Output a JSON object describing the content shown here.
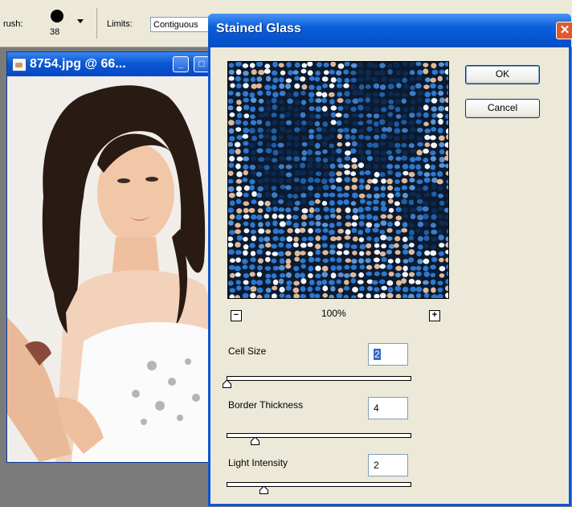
{
  "options_bar": {
    "brush_label": "rush:",
    "brush_size": "38",
    "limits_label": "Limits:",
    "limits_value": "Contiguous"
  },
  "document_window": {
    "title": "8754.jpg @ 66...",
    "minimize_glyph": "_",
    "restore_glyph": "□"
  },
  "dialog": {
    "title": "Stained Glass",
    "close_glyph": "✕",
    "ok_label": "OK",
    "cancel_label": "Cancel",
    "zoom_out_glyph": "−",
    "zoom_in_glyph": "+",
    "zoom_level": "100%",
    "params": [
      {
        "label": "Cell Size",
        "value": "2",
        "slider_fraction": 0.0
      },
      {
        "label": "Border Thickness",
        "value": "4",
        "slider_fraction": 0.15
      },
      {
        "label": "Light Intensity",
        "value": "2",
        "slider_fraction": 0.2
      }
    ]
  },
  "colors": {
    "xp_title_blue": "#0a5fda",
    "dialog_face": "#ece9d8",
    "close_red": "#e05a2d",
    "selection_blue": "#316ac5",
    "preview_cells": "#2a72c8",
    "preview_leading": "#0b1a2e"
  }
}
